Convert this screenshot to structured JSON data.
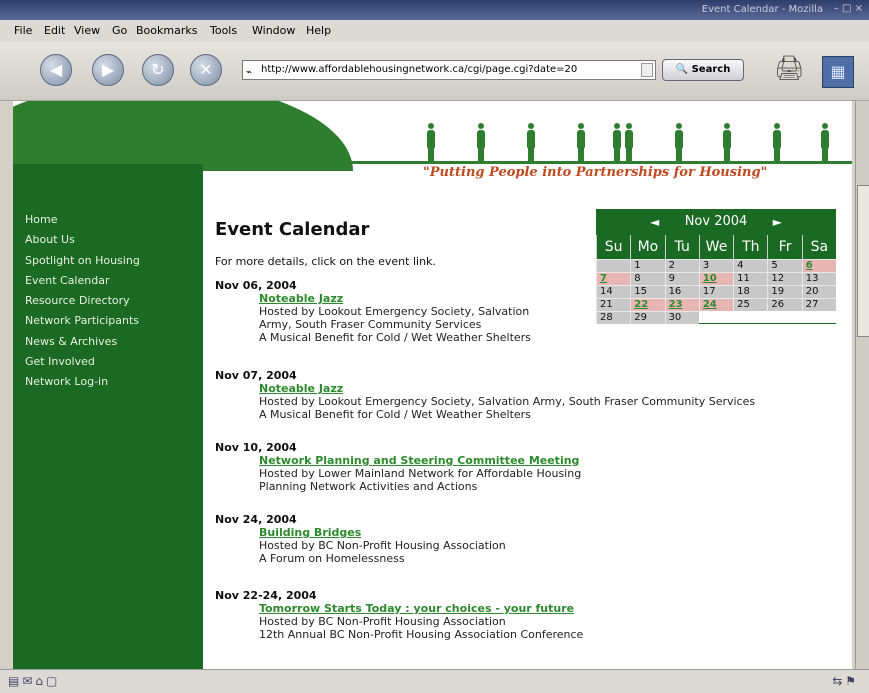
{
  "window": {
    "title": "Event Calendar - Mozilla"
  },
  "menu": [
    "File",
    "Edit",
    "View",
    "Go",
    "Bookmarks",
    "Tools",
    "Window",
    "Help"
  ],
  "toolbar": {
    "url": "http://www.affordablehousingnetwork.ca/cgi/page.cgi?date=20",
    "search_label": "Search"
  },
  "site": {
    "tagline": "\"Putting People into Partnerships for Housing\""
  },
  "sidebar": {
    "items": [
      "Home",
      "About Us",
      "Spotlight on Housing",
      "Event Calendar",
      "Resource Directory",
      "Network Participants",
      "News & Archives",
      "Get Involved",
      "Network Log-in"
    ]
  },
  "main": {
    "title": "Event Calendar",
    "intro": "For more details, click on the event link."
  },
  "calendar": {
    "month_label": "Nov 2004",
    "prev": "◄",
    "next": "►",
    "weekdays": [
      "Su",
      "Mo",
      "Tu",
      "We",
      "Th",
      "Fr",
      "Sa"
    ],
    "cells": [
      {
        "d": "",
        "ev": false
      },
      {
        "d": "1",
        "ev": false
      },
      {
        "d": "2",
        "ev": false
      },
      {
        "d": "3",
        "ev": false
      },
      {
        "d": "4",
        "ev": false
      },
      {
        "d": "5",
        "ev": false
      },
      {
        "d": "6",
        "ev": true
      },
      {
        "d": "7",
        "ev": true
      },
      {
        "d": "8",
        "ev": false
      },
      {
        "d": "9",
        "ev": false
      },
      {
        "d": "10",
        "ev": true
      },
      {
        "d": "11",
        "ev": false
      },
      {
        "d": "12",
        "ev": false
      },
      {
        "d": "13",
        "ev": false
      },
      {
        "d": "14",
        "ev": false
      },
      {
        "d": "15",
        "ev": false
      },
      {
        "d": "16",
        "ev": false
      },
      {
        "d": "17",
        "ev": false
      },
      {
        "d": "18",
        "ev": false
      },
      {
        "d": "19",
        "ev": false
      },
      {
        "d": "20",
        "ev": false
      },
      {
        "d": "21",
        "ev": false
      },
      {
        "d": "22",
        "ev": true
      },
      {
        "d": "23",
        "ev": true
      },
      {
        "d": "24",
        "ev": true
      },
      {
        "d": "25",
        "ev": false
      },
      {
        "d": "26",
        "ev": false
      },
      {
        "d": "27",
        "ev": false
      },
      {
        "d": "28",
        "ev": false
      },
      {
        "d": "29",
        "ev": false
      },
      {
        "d": "30",
        "ev": false
      },
      {
        "d": "",
        "ev": false,
        "blank": true
      },
      {
        "d": "",
        "ev": false,
        "blank": true
      },
      {
        "d": "",
        "ev": false,
        "blank": true
      },
      {
        "d": "",
        "ev": false,
        "blank": true
      }
    ]
  },
  "events": [
    {
      "date": "Nov 06, 2004",
      "title": "Noteable Jazz",
      "lines": [
        "Hosted by Lookout Emergency Society, Salvation",
        "Army, South Fraser Community Services",
        "A Musical Benefit for Cold / Wet Weather Shelters"
      ]
    },
    {
      "date": "Nov 07, 2004",
      "title": "Noteable Jazz",
      "lines": [
        "Hosted by Lookout Emergency Society, Salvation Army, South Fraser Community Services",
        "A Musical Benefit for Cold / Wet Weather Shelters"
      ]
    },
    {
      "date": "Nov 10, 2004",
      "title": "Network Planning and Steering Committee Meeting",
      "lines": [
        "Hosted by Lower Mainland Network for Affordable Housing",
        "Planning Network Activities and Actions"
      ]
    },
    {
      "date": "Nov 24, 2004",
      "title": "Building Bridges",
      "lines": [
        "Hosted by BC Non-Profit Housing Association",
        "A Forum on Homelessness"
      ]
    },
    {
      "date": "Nov 22-24, 2004",
      "title": "Tomorrow Starts Today : your choices - your future",
      "lines": [
        "Hosted by BC Non-Profit Housing Association",
        "12th Annual BC Non-Profit Housing Association Conference"
      ]
    }
  ]
}
